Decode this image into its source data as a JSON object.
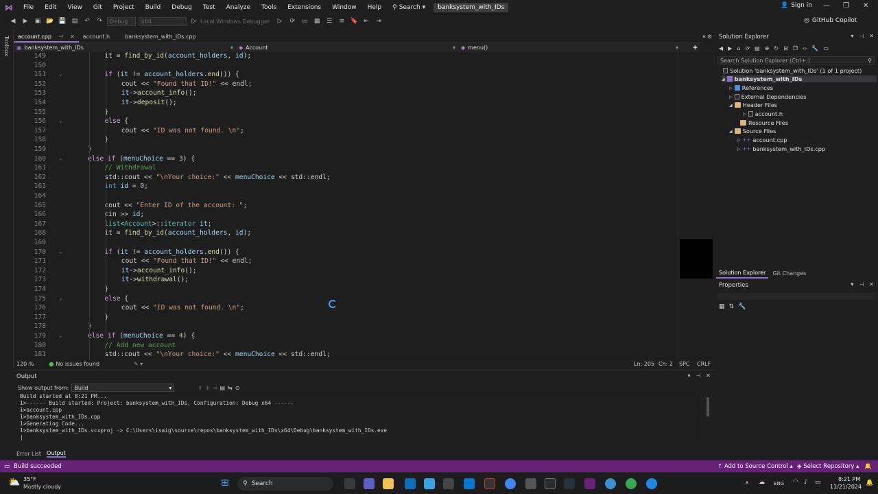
{
  "menu": {
    "items": [
      "File",
      "Edit",
      "View",
      "Git",
      "Project",
      "Build",
      "Debug",
      "Test",
      "Analyze",
      "Tools",
      "Extensions",
      "Window",
      "Help"
    ],
    "search_label": "Search",
    "solution_name": "banksystem_with_IDs",
    "sign_in": "Sign in"
  },
  "toolbar": {
    "config": "Debug",
    "platform": "x64",
    "run_target": "Local Windows Debugger",
    "copilot": "GitHub Copilot"
  },
  "toolbox": "Toolbox",
  "doc_tabs": [
    {
      "label": "account.cpp",
      "active": true
    },
    {
      "label": "account.h",
      "active": false
    },
    {
      "label": "banksystem_with_IDs.cpp",
      "active": false
    }
  ],
  "navbar": {
    "project": "banksystem_with_IDs",
    "scope": "Account",
    "member": "menu()"
  },
  "editor": {
    "lines": [
      {
        "n": "149",
        "indent": 3,
        "html": "it = <span class='fn'>find_by_id</span>(<span class='var'>account_holders</span>, <span class='var'>id</span>);"
      },
      {
        "n": "150",
        "indent": 0,
        "html": ""
      },
      {
        "n": "151",
        "indent": 3,
        "fold": true,
        "html": "<span class='kc'>if</span> (<span class='var'>it</span> != <span class='var'>account_holders</span>.<span class='fn'>end</span>()) {"
      },
      {
        "n": "152",
        "indent": 4,
        "html": "cout &lt;&lt; <span class='str'>\"Found that ID!\"</span> &lt;&lt; endl;"
      },
      {
        "n": "153",
        "indent": 4,
        "html": "<span class='var'>it</span>-&gt;<span class='fn'>account_info</span>();"
      },
      {
        "n": "154",
        "indent": 4,
        "html": "<span class='var'>it</span>-&gt;<span class='fn'>deposit</span>();"
      },
      {
        "n": "155",
        "indent": 3,
        "html": "}"
      },
      {
        "n": "156",
        "indent": 3,
        "fold": true,
        "html": "<span class='kc'>else</span> {"
      },
      {
        "n": "157",
        "indent": 4,
        "html": "cout &lt;&lt; <span class='str'>\"ID was not found. \\n\"</span>;"
      },
      {
        "n": "158",
        "indent": 3,
        "html": "}"
      },
      {
        "n": "159",
        "indent": 2,
        "html": "}"
      },
      {
        "n": "160",
        "indent": 2,
        "fold": true,
        "html": "<span class='kc'>else if</span> (<span class='var'>menuChoice</span> == <span class='num'>3</span>) {"
      },
      {
        "n": "161",
        "indent": 3,
        "html": "<span class='cm'>// Withdrawal</span>"
      },
      {
        "n": "162",
        "indent": 3,
        "html": "std::cout &lt;&lt; <span class='str'>\"\\nYour choice:\"</span> &lt;&lt; <span class='var'>menuChoice</span> &lt;&lt; std::endl;"
      },
      {
        "n": "163",
        "indent": 3,
        "html": "<span class='kw'>int</span> <span class='var'>id</span> = <span class='num'>0</span>;"
      },
      {
        "n": "164",
        "indent": 0,
        "html": ""
      },
      {
        "n": "165",
        "indent": 3,
        "html": "cout &lt;&lt; <span class='str'>\"Enter ID of the account: \"</span>;"
      },
      {
        "n": "166",
        "indent": 3,
        "html": "cin &gt;&gt; <span class='var'>id</span>;"
      },
      {
        "n": "167",
        "indent": 3,
        "html": "<span class='ty'>list</span>&lt;<span class='ty'>Account</span>&gt;::<span class='ty'>iterator</span> <span class='var'>it</span>;"
      },
      {
        "n": "168",
        "indent": 3,
        "html": "it = <span class='fn'>find_by_id</span>(<span class='var'>account_holders</span>, <span class='var'>id</span>);"
      },
      {
        "n": "169",
        "indent": 0,
        "html": ""
      },
      {
        "n": "170",
        "indent": 3,
        "fold": true,
        "html": "<span class='kc'>if</span> (<span class='var'>it</span> != <span class='var'>account_holders</span>.<span class='fn'>end</span>()) {"
      },
      {
        "n": "171",
        "indent": 4,
        "html": "cout &lt;&lt; <span class='str'>\"Found that ID!\"</span> &lt;&lt; endl;"
      },
      {
        "n": "172",
        "indent": 4,
        "html": "<span class='var'>it</span>-&gt;<span class='fn'>account_info</span>();"
      },
      {
        "n": "173",
        "indent": 4,
        "html": "<span class='var'>it</span>-&gt;<span class='fn'>withdrawal</span>();"
      },
      {
        "n": "174",
        "indent": 3,
        "html": "}"
      },
      {
        "n": "175",
        "indent": 3,
        "fold": true,
        "html": "<span class='kc'>else</span> {"
      },
      {
        "n": "176",
        "indent": 4,
        "html": "cout &lt;&lt; <span class='str'>\"ID was not found. \\n\"</span>;"
      },
      {
        "n": "177",
        "indent": 3,
        "html": "}"
      },
      {
        "n": "178",
        "indent": 2,
        "html": "}"
      },
      {
        "n": "179",
        "indent": 2,
        "fold": true,
        "html": "<span class='kc'>else if</span> (<span class='var'>menuChoice</span> == <span class='num'>4</span>) {"
      },
      {
        "n": "180",
        "indent": 3,
        "html": "<span class='cm'>// Add new account</span>"
      },
      {
        "n": "181",
        "indent": 3,
        "html": "std::cout &lt;&lt; <span class='str'>\"\\nYour choice:\"</span> &lt;&lt; <span class='var'>menuChoice</span> &lt;&lt; std::endl;"
      }
    ]
  },
  "editor_status": {
    "zoom": "120 %",
    "issues": "No issues found",
    "ln": "Ln: 205",
    "ch": "Ch: 2",
    "spc": "SPC",
    "eol": "CRLF"
  },
  "solution_explorer": {
    "title": "Solution Explorer",
    "search_placeholder": "Search Solution Explorer (Ctrl+;)",
    "solution_label": "Solution 'banksystem_with_IDs' (1 of 1 project)",
    "project": "banksystem_with_IDs",
    "references": "References",
    "external": "External Dependencies",
    "header_files": "Header Files",
    "account_h": "account.h",
    "resource_files": "Resource Files",
    "source_files": "Source Files",
    "account_cpp": "account.cpp",
    "main_cpp": "banksystem_with_IDs.cpp",
    "tab_se": "Solution Explorer",
    "tab_git": "Git Changes"
  },
  "properties": {
    "title": "Properties"
  },
  "output": {
    "title": "Output",
    "show_from_label": "Show output from:",
    "show_from_value": "Build",
    "text": "Build started at 8:21 PM...\n1>------ Build started: Project: banksystem_with_IDs, Configuration: Debug x64 ------\n1>account.cpp\n1>banksystem_with_IDs.cpp\n1>Generating Code...\n1>banksystem_with_IDs.vcxproj -> C:\\Users\\isaig\\source\\repos\\banksystem_with_IDs\\x64\\Debug\\banksystem_with_IDs.exe\n|",
    "tab_errors": "Error List",
    "tab_output": "Output"
  },
  "statusbar": {
    "message": "Build succeeded",
    "source_control": "Add to Source Control",
    "repo": "Select Repository"
  },
  "taskbar": {
    "temp": "35°F",
    "weather": "Mostly cloudy",
    "search": "Search",
    "lang": "ENG",
    "time": "8:21 PM",
    "date": "11/21/2024"
  },
  "colors": {
    "accent": "#68217a",
    "tab_underline": "#8a6fd1"
  }
}
